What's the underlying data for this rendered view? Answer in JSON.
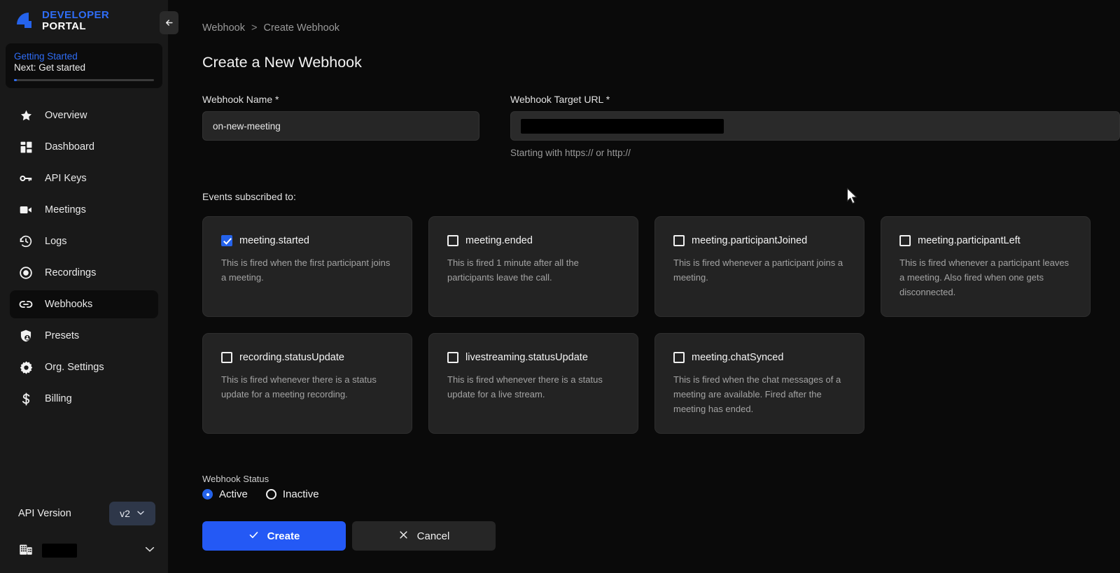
{
  "brand": {
    "line1": "DEVELOPER",
    "line2": "PORTAL",
    "logo_color": "#2563eb"
  },
  "getting_started": {
    "title": "Getting Started",
    "next": "Next: Get started",
    "progress_percent": 2
  },
  "sidebar": {
    "items": [
      {
        "label": "Overview",
        "icon": "star-icon",
        "active": false
      },
      {
        "label": "Dashboard",
        "icon": "dashboard-icon",
        "active": false
      },
      {
        "label": "API Keys",
        "icon": "key-icon",
        "active": false
      },
      {
        "label": "Meetings",
        "icon": "video-camera-icon",
        "active": false
      },
      {
        "label": "Logs",
        "icon": "history-clock-icon",
        "active": false
      },
      {
        "label": "Recordings",
        "icon": "record-circle-icon",
        "active": false
      },
      {
        "label": "Webhooks",
        "icon": "link-chain-icon",
        "active": true
      },
      {
        "label": "Presets",
        "icon": "shield-user-icon",
        "active": false
      },
      {
        "label": "Org. Settings",
        "icon": "gear-icon",
        "active": false
      },
      {
        "label": "Billing",
        "icon": "dollar-icon",
        "active": false
      }
    ],
    "api_version_label": "API Version",
    "api_version_value": "v2",
    "org_name": "",
    "collapse_tooltip": "Collapse sidebar"
  },
  "breadcrumb": {
    "parent": "Webhook",
    "separator": ">",
    "current": "Create Webhook"
  },
  "page": {
    "title": "Create a New Webhook"
  },
  "form": {
    "name": {
      "label": "Webhook Name",
      "required": "*",
      "value": "on-new-meeting",
      "placeholder": "Webhook Name"
    },
    "url": {
      "label": "Webhook Target URL",
      "required": "*",
      "value": "",
      "placeholder": "https://",
      "hint": "Starting with https:// or http://"
    },
    "events_label": "Events subscribed to:",
    "events": [
      {
        "name": "meeting.started",
        "checked": true,
        "description": "This is fired when the first participant joins a meeting."
      },
      {
        "name": "meeting.ended",
        "checked": false,
        "description": "This is fired 1 minute after all the participants leave the call."
      },
      {
        "name": "meeting.participantJoined",
        "checked": false,
        "description": "This is fired whenever a participant joins a meeting."
      },
      {
        "name": "meeting.participantLeft",
        "checked": false,
        "description": "This is fired whenever a participant leaves a meeting. Also fired when one gets disconnected."
      },
      {
        "name": "recording.statusUpdate",
        "checked": false,
        "description": "This is fired whenever there is a status update for a meeting recording."
      },
      {
        "name": "livestreaming.statusUpdate",
        "checked": false,
        "description": "This is fired whenever there is a status update for a live stream."
      },
      {
        "name": "meeting.chatSynced",
        "checked": false,
        "description": "This is fired when the chat messages of a meeting are available. Fired after the meeting has ended."
      }
    ],
    "status": {
      "label": "Webhook Status",
      "options": [
        {
          "label": "Active",
          "selected": true
        },
        {
          "label": "Inactive",
          "selected": false
        }
      ]
    },
    "buttons": {
      "create": "Create",
      "cancel": "Cancel"
    }
  },
  "colors": {
    "accent": "#2563eb",
    "primary_button": "#2459f5",
    "sidebar_bg": "#191919",
    "page_bg": "#0a0a0a",
    "card_bg": "#232323"
  }
}
